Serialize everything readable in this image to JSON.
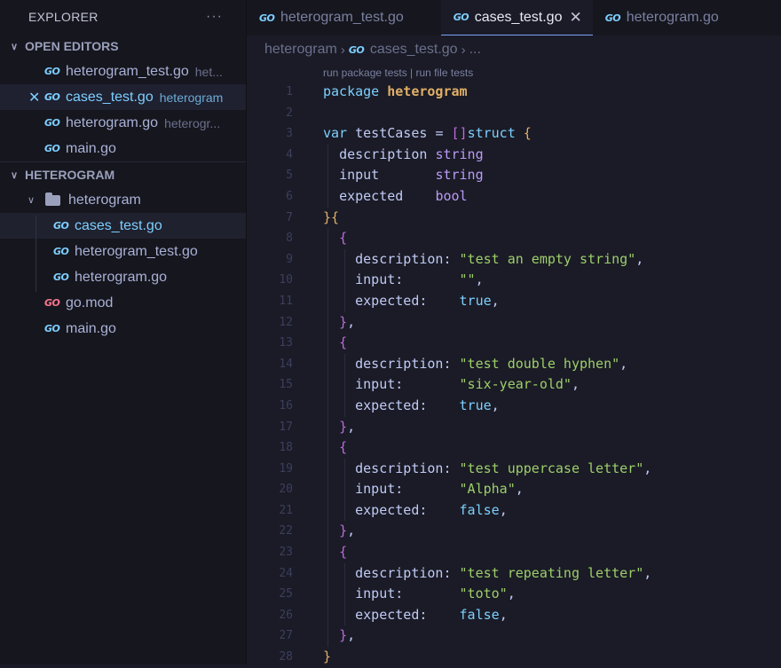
{
  "explorer": {
    "title": "EXPLORER",
    "more": "···",
    "open_editors_label": "OPEN EDITORS",
    "open_editors": [
      {
        "name": "heterogram_test.go",
        "desc": "het..."
      },
      {
        "name": "cases_test.go",
        "desc": "heterogram"
      },
      {
        "name": "heterogram.go",
        "desc": "heterogr..."
      },
      {
        "name": "main.go",
        "desc": ""
      }
    ],
    "project_label": "HETEROGRAM",
    "folder": "heterogram",
    "folder_files": [
      "cases_test.go",
      "heterogram_test.go",
      "heterogram.go"
    ],
    "root_files": [
      "go.mod",
      "main.go"
    ]
  },
  "icons": {
    "go": "GO",
    "close": "✕",
    "chevron": "❯"
  },
  "tabs": [
    {
      "label": "heterogram_test.go"
    },
    {
      "label": "cases_test.go",
      "close": "✕"
    },
    {
      "label": "heterogram.go"
    }
  ],
  "breadcrumb": {
    "folder": "heterogram",
    "file": "cases_test.go",
    "more": "..."
  },
  "codelens": "run package tests | run file tests",
  "code": {
    "l1": {
      "kw": "package",
      "name": "heterogram"
    },
    "l3": {
      "kw": "var",
      "name": "testCases",
      "eq": "=",
      "open": "[]",
      "kw2": "struct",
      "brace": "{"
    },
    "fields": [
      {
        "name": "description",
        "pad": " ",
        "type": "string"
      },
      {
        "name": "input",
        "pad": "       ",
        "type": "string"
      },
      {
        "name": "expected",
        "pad": "    ",
        "type": "bool"
      }
    ],
    "l7": {
      "close": "}",
      "open": "{"
    },
    "cases": [
      {
        "description": "\"test an empty string\"",
        "input": "\"\"",
        "expected": "true"
      },
      {
        "description": "\"test double hyphen\"",
        "input": "\"six-year-old\"",
        "expected": "true"
      },
      {
        "description": "\"test uppercase letter\"",
        "input": "\"Alpha\"",
        "expected": "false"
      },
      {
        "description": "\"test repeating letter\"",
        "input": "\"toto\"",
        "expected": "false"
      }
    ],
    "keys": {
      "description": "description:",
      "input": "input:",
      "expected": "expected:"
    },
    "l28": "}"
  },
  "line_numbers": [
    "1",
    "2",
    "3",
    "4",
    "5",
    "6",
    "7",
    "8",
    "9",
    "10",
    "11",
    "12",
    "13",
    "14",
    "15",
    "16",
    "17",
    "18",
    "19",
    "20",
    "21",
    "22",
    "23",
    "24",
    "25",
    "26",
    "27",
    "28"
  ]
}
